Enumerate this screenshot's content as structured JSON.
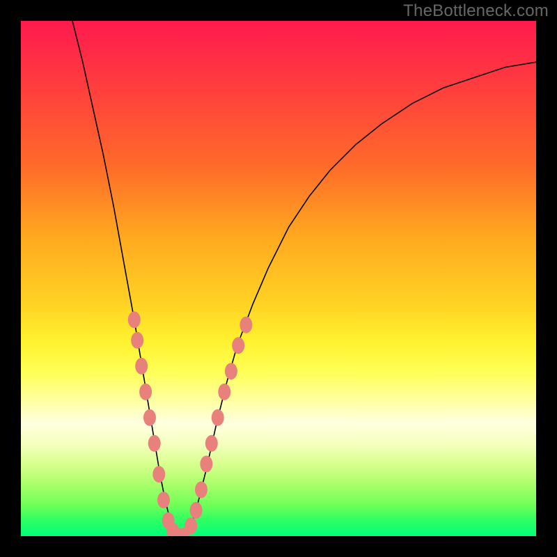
{
  "watermark": "TheBottleneck.com",
  "colors": {
    "frame": "#000000",
    "curve": "#000000",
    "dots": "#e8817c",
    "gradient_top": "#ff1a4e",
    "gradient_bottom": "#00ff7a",
    "watermark_text": "#676767"
  },
  "chart_data": {
    "type": "line",
    "title": "",
    "xlabel": "",
    "ylabel": "",
    "xlim": [
      0,
      100
    ],
    "ylim": [
      0,
      100
    ],
    "grid": false,
    "legend": false,
    "series": [
      {
        "name": "bottleneck-curve",
        "x": [
          10,
          12,
          14,
          16,
          18,
          20,
          22,
          23,
          24,
          25,
          26,
          27,
          28,
          29,
          30,
          31,
          32,
          33,
          34,
          35,
          36,
          38,
          40,
          42,
          45,
          48,
          52,
          56,
          60,
          65,
          70,
          76,
          82,
          88,
          94,
          100
        ],
        "y": [
          100,
          92,
          83,
          74,
          64,
          53,
          42,
          36,
          30,
          24,
          18,
          12,
          7,
          3,
          0,
          0,
          0,
          2,
          5,
          9,
          13,
          22,
          30,
          37,
          45,
          52,
          60,
          66,
          71,
          76,
          80,
          84,
          87,
          89,
          91,
          92
        ]
      }
    ],
    "annotations": {
      "highlighted_points_left": [
        {
          "x": 22.0,
          "y": 42
        },
        {
          "x": 22.6,
          "y": 38
        },
        {
          "x": 23.4,
          "y": 33
        },
        {
          "x": 24.2,
          "y": 28
        },
        {
          "x": 25.0,
          "y": 23
        },
        {
          "x": 25.9,
          "y": 18
        },
        {
          "x": 26.8,
          "y": 12
        },
        {
          "x": 27.7,
          "y": 7
        },
        {
          "x": 28.6,
          "y": 3
        },
        {
          "x": 29.5,
          "y": 1
        },
        {
          "x": 30.5,
          "y": 0
        },
        {
          "x": 31.5,
          "y": 0
        }
      ],
      "highlighted_points_right": [
        {
          "x": 33.0,
          "y": 2
        },
        {
          "x": 34.0,
          "y": 5
        },
        {
          "x": 35.0,
          "y": 9
        },
        {
          "x": 36.0,
          "y": 14
        },
        {
          "x": 37.0,
          "y": 18
        },
        {
          "x": 38.2,
          "y": 23
        },
        {
          "x": 39.5,
          "y": 28
        },
        {
          "x": 40.8,
          "y": 32
        },
        {
          "x": 42.2,
          "y": 37
        },
        {
          "x": 43.7,
          "y": 41
        }
      ]
    }
  }
}
